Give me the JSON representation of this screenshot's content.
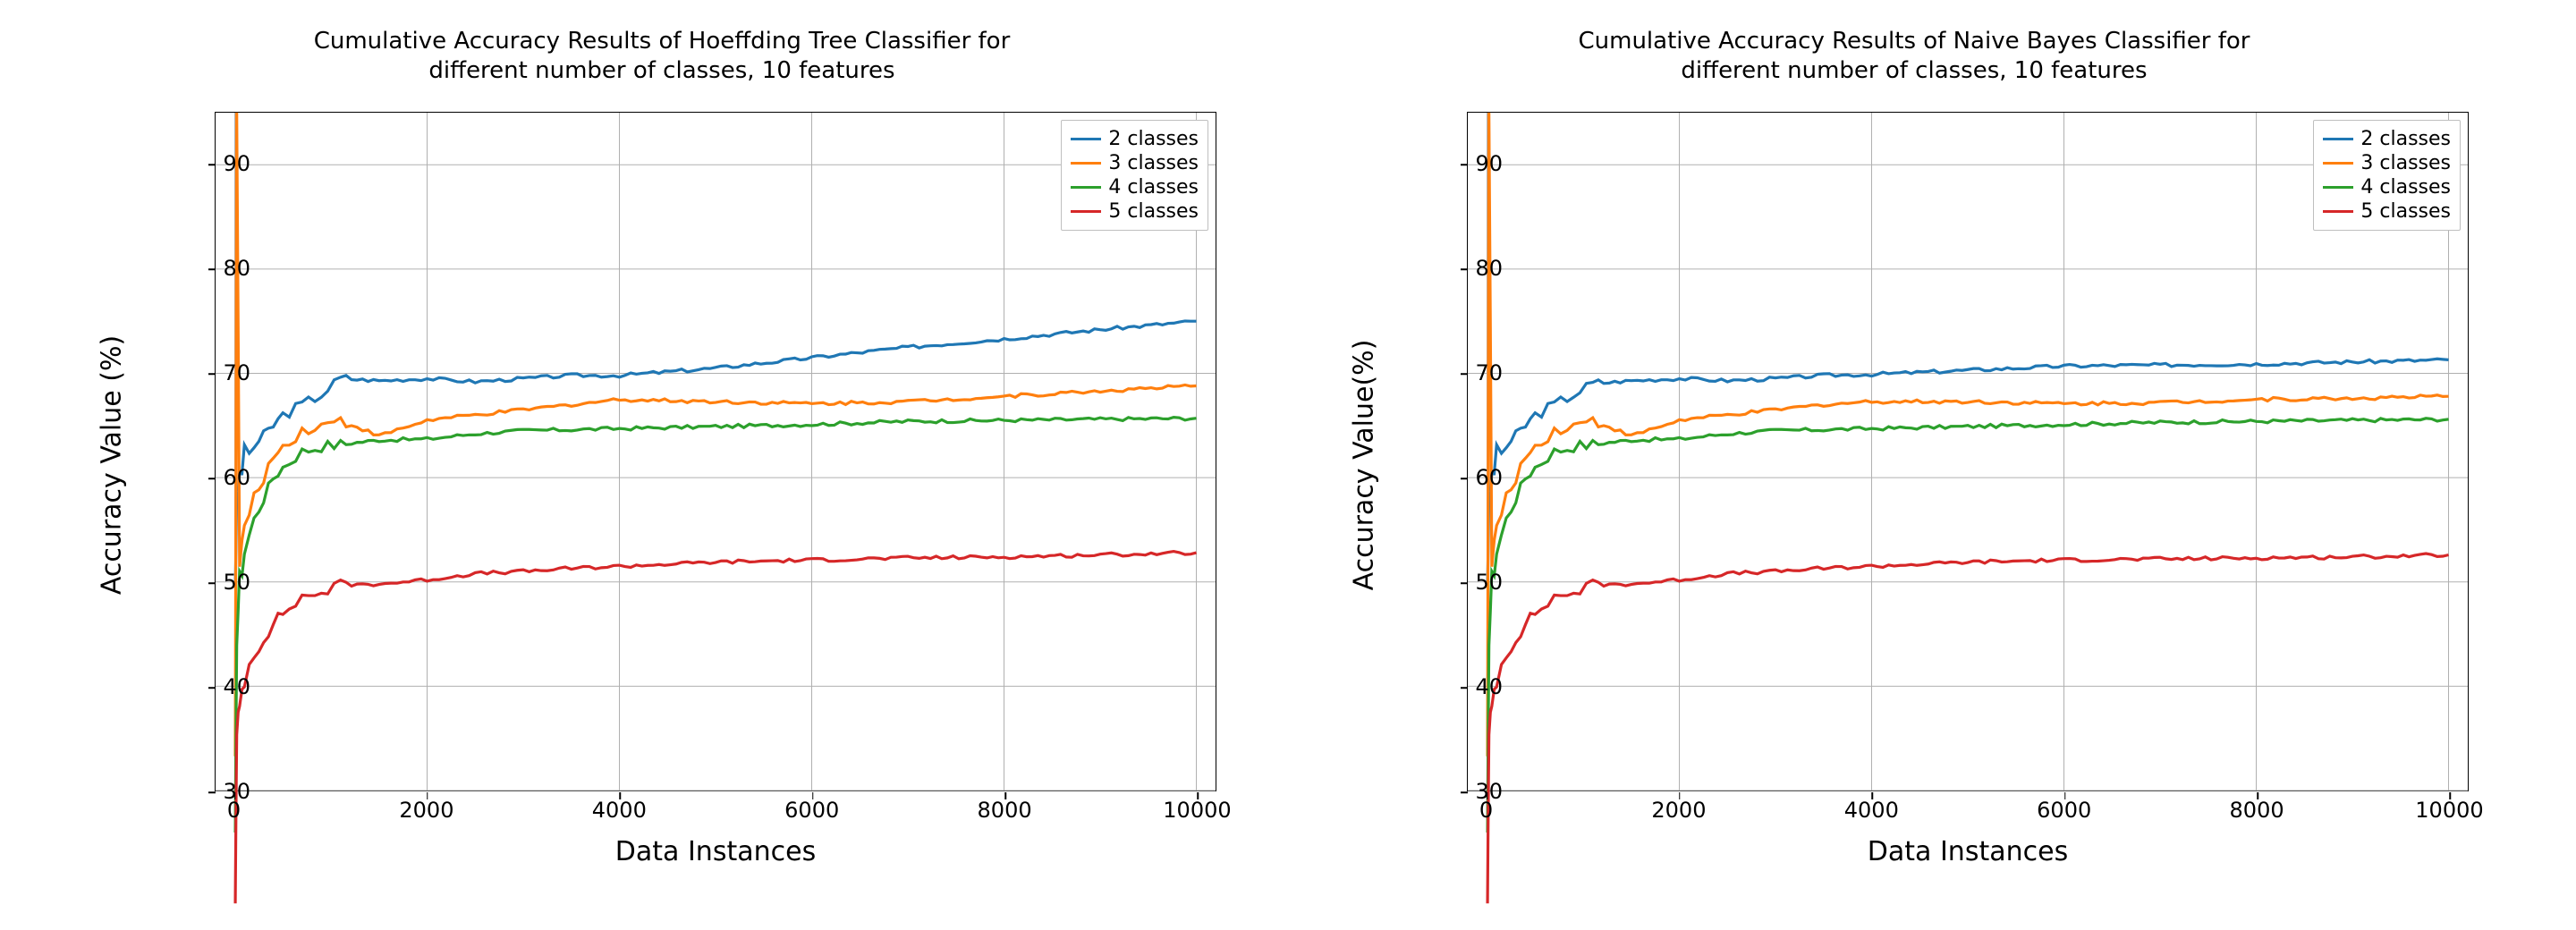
{
  "colors": {
    "blue": "#1f77b4",
    "orange": "#ff7f0e",
    "green": "#2ca02c",
    "red": "#d62728"
  },
  "chart_data": [
    {
      "type": "line",
      "title": "Cumulative Accuracy Results of Hoeffding Tree Classifier for\ndifferent number of classes, 10 features",
      "xlabel": "Data Instances",
      "ylabel": "Accuracy Value (%)",
      "xlim": [
        -200,
        10200
      ],
      "ylim": [
        30,
        95
      ],
      "xticks": [
        0,
        2000,
        4000,
        6000,
        8000,
        10000
      ],
      "yticks": [
        30,
        40,
        50,
        60,
        70,
        80,
        90
      ],
      "legend_position": "upper right",
      "grid": true,
      "x": [
        5,
        20,
        50,
        100,
        200,
        300,
        400,
        500,
        700,
        900,
        1100,
        1500,
        2000,
        2500,
        3000,
        3500,
        4000,
        5000,
        6000,
        7000,
        8000,
        9000,
        10000
      ],
      "series": [
        {
          "name": "2 classes",
          "color": "blue",
          "values": [
            50,
            58,
            60,
            62,
            63,
            64,
            65,
            66,
            67,
            68,
            69.5,
            69.3,
            69.5,
            69.2,
            69.5,
            69.8,
            69.8,
            70.5,
            71.5,
            72.5,
            73.3,
            74.2,
            75
          ]
        },
        {
          "name": "3 classes",
          "color": "orange",
          "values": [
            33,
            95,
            52,
            55,
            58,
            60,
            62,
            63,
            64.5,
            65,
            65.5,
            64,
            65.5,
            66,
            66.5,
            67,
            67.5,
            67.3,
            67.1,
            67.3,
            67.8,
            68.3,
            68.8
          ]
        },
        {
          "name": "4 classes",
          "color": "green",
          "values": [
            25,
            45,
            50,
            53,
            56,
            58,
            60,
            61,
            62.5,
            63,
            63.2,
            63.6,
            63.7,
            64.2,
            64.5,
            64.6,
            64.7,
            64.9,
            65.1,
            65.4,
            65.5,
            65.6,
            65.7
          ]
        },
        {
          "name": "5 classes",
          "color": "red",
          "values": [
            20,
            35,
            38,
            41,
            43,
            44.5,
            46,
            47,
            48.5,
            49,
            49.7,
            49.8,
            50.2,
            50.8,
            51,
            51.3,
            51.5,
            51.9,
            52.1,
            52.3,
            52.4,
            52.6,
            52.8
          ]
        }
      ]
    },
    {
      "type": "line",
      "title": "Cumulative Accuracy Results of Naive Bayes Classifier for\ndifferent number of classes, 10 features",
      "xlabel": "Data Instances",
      "ylabel": "Accuracy Value(%)",
      "xlim": [
        -200,
        10200
      ],
      "ylim": [
        30,
        95
      ],
      "xticks": [
        0,
        2000,
        4000,
        6000,
        8000,
        10000
      ],
      "yticks": [
        30,
        40,
        50,
        60,
        70,
        80,
        90
      ],
      "legend_position": "upper right",
      "grid": true,
      "x": [
        5,
        20,
        50,
        100,
        200,
        300,
        400,
        500,
        700,
        900,
        1100,
        1500,
        2000,
        2500,
        3000,
        3500,
        4000,
        5000,
        6000,
        7000,
        8000,
        9000,
        10000
      ],
      "series": [
        {
          "name": "2 classes",
          "color": "blue",
          "values": [
            50,
            58,
            60,
            62,
            63,
            64,
            65,
            66,
            67,
            68,
            69,
            69.3,
            69.5,
            69.3,
            69.5,
            69.8,
            69.9,
            70.3,
            70.7,
            70.8,
            70.9,
            71.1,
            71.3
          ]
        },
        {
          "name": "3 classes",
          "color": "orange",
          "values": [
            33,
            95,
            52,
            55,
            58,
            60,
            62,
            63,
            64.5,
            65,
            65.5,
            64,
            65.5,
            66,
            66.5,
            67,
            67.3,
            67.3,
            67.1,
            67.2,
            67.5,
            67.6,
            67.8
          ]
        },
        {
          "name": "4 classes",
          "color": "green",
          "values": [
            25,
            45,
            50,
            53,
            56,
            58,
            60,
            61,
            62.5,
            63,
            63.2,
            63.6,
            63.7,
            64.2,
            64.5,
            64.6,
            64.7,
            64.9,
            65.1,
            65.3,
            65.4,
            65.5,
            65.6
          ]
        },
        {
          "name": "5 classes",
          "color": "red",
          "values": [
            20,
            35,
            38,
            41,
            43,
            44.5,
            46,
            47,
            48.5,
            49,
            49.7,
            49.8,
            50.2,
            50.8,
            51,
            51.3,
            51.5,
            51.9,
            52.1,
            52.2,
            52.3,
            52.4,
            52.6
          ]
        }
      ]
    }
  ]
}
